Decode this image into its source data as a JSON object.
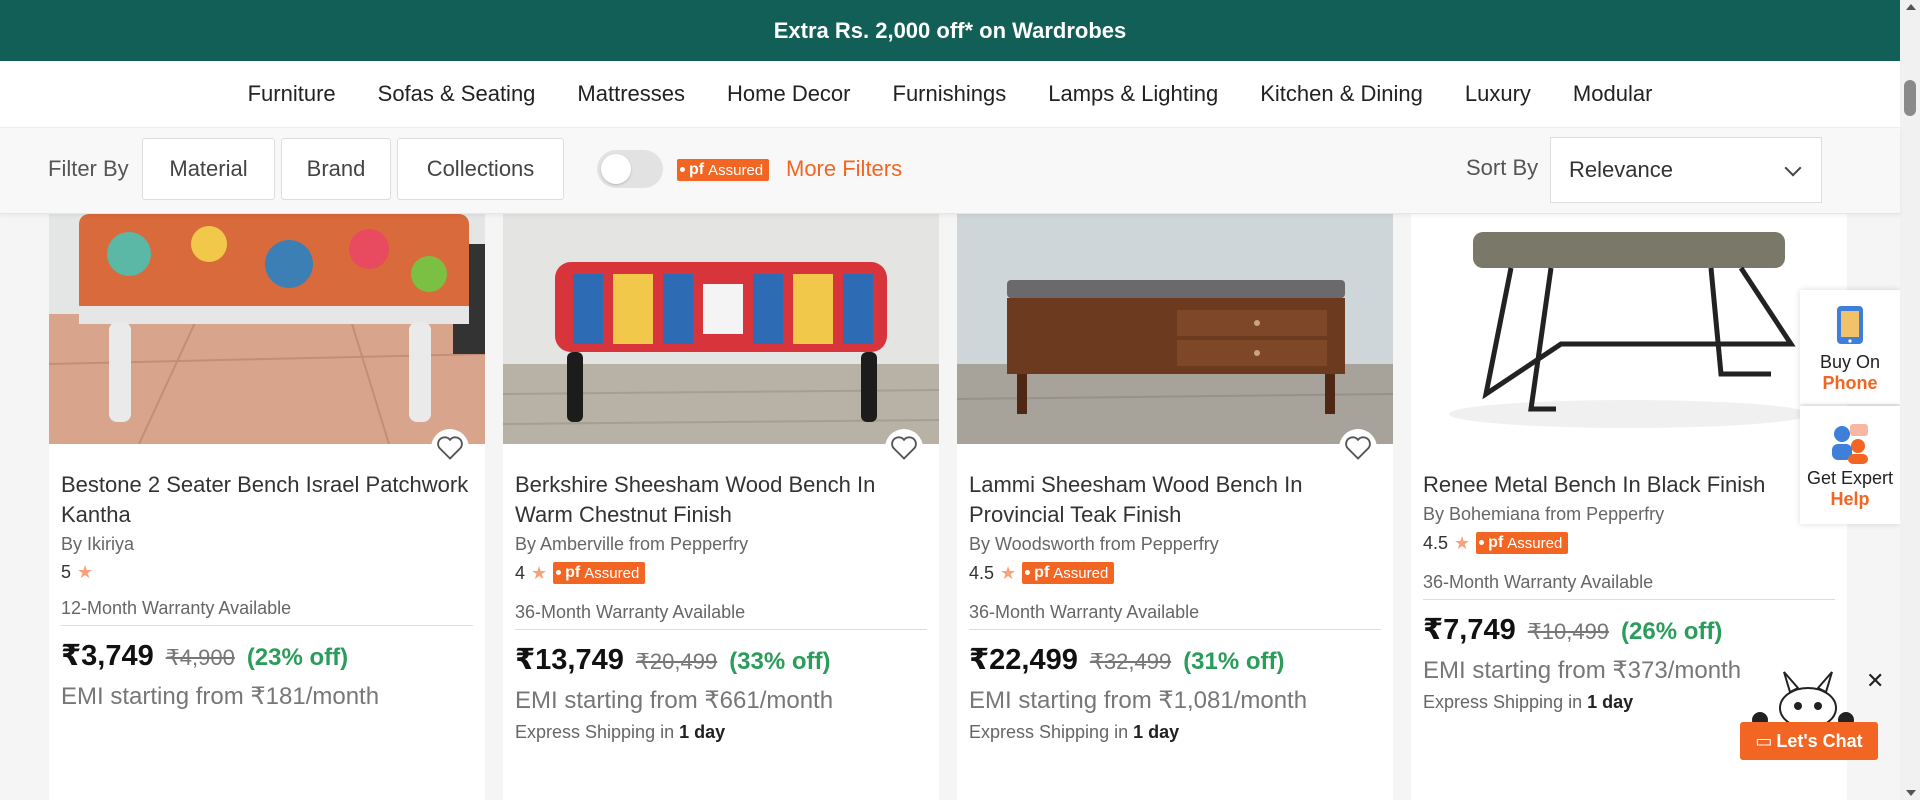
{
  "promo": {
    "text": "Extra Rs. 2,000 off* on Wardrobes"
  },
  "nav": [
    "Furniture",
    "Sofas & Seating",
    "Mattresses",
    "Home Decor",
    "Furnishings",
    "Lamps & Lighting",
    "Kitchen & Dining",
    "Luxury",
    "Modular"
  ],
  "filters": {
    "label": "Filter By",
    "buttons": [
      "Material",
      "Brand",
      "Collections"
    ],
    "pf_assured_toggle_on": false,
    "badge_pf": "pf",
    "badge_assured": "Assured",
    "more_filters": "More Filters",
    "sort_label": "Sort By",
    "sort_value": "Relevance"
  },
  "products": [
    {
      "title": "Bestone 2 Seater Bench Israel Patchwork Kantha",
      "brand": "By Ikiriya",
      "rating": "5",
      "pf_assured": false,
      "warranty": "12-Month Warranty Available",
      "price": "₹3,749",
      "mrp": "₹4,900",
      "off": "(23% off)",
      "emi": "EMI starting from ₹181/month",
      "ship_prefix": "",
      "ship_days": ""
    },
    {
      "title": "Berkshire Sheesham Wood Bench In Warm Chestnut Finish",
      "brand": "By Amberville from Pepperfry",
      "rating": "4",
      "pf_assured": true,
      "warranty": "36-Month Warranty Available",
      "price": "₹13,749",
      "mrp": "₹20,499",
      "off": "(33% off)",
      "emi": "EMI starting from ₹661/month",
      "ship_prefix": "Express Shipping in",
      "ship_days": "1 day"
    },
    {
      "title": "Lammi Sheesham Wood Bench In Provincial Teak Finish",
      "brand": "By Woodsworth from Pepperfry",
      "rating": "4.5",
      "pf_assured": true,
      "warranty": "36-Month Warranty Available",
      "price": "₹22,499",
      "mrp": "₹32,499",
      "off": "(31% off)",
      "emi": "EMI starting from ₹1,081/month",
      "ship_prefix": "Express Shipping in",
      "ship_days": "1 day"
    },
    {
      "title": "Renee Metal Bench In Black Finish",
      "brand": "By Bohemiana from Pepperfry",
      "rating": "4.5",
      "pf_assured": true,
      "warranty": "36-Month Warranty Available",
      "price": "₹7,749",
      "mrp": "₹10,499",
      "off": "(26% off)",
      "emi": "EMI starting from ₹373/month",
      "ship_prefix": "Express Shipping in",
      "ship_days": "1 day"
    }
  ],
  "side": {
    "buy_line1": "Buy On",
    "buy_line2": "Phone",
    "help_line1": "Get Expert",
    "help_line2": "Help"
  },
  "chat": {
    "label": "Let's Chat",
    "close": "✕"
  },
  "colors": {
    "promo_bg": "#125f57",
    "accent": "#f26522",
    "discount": "#2a9d5b"
  }
}
